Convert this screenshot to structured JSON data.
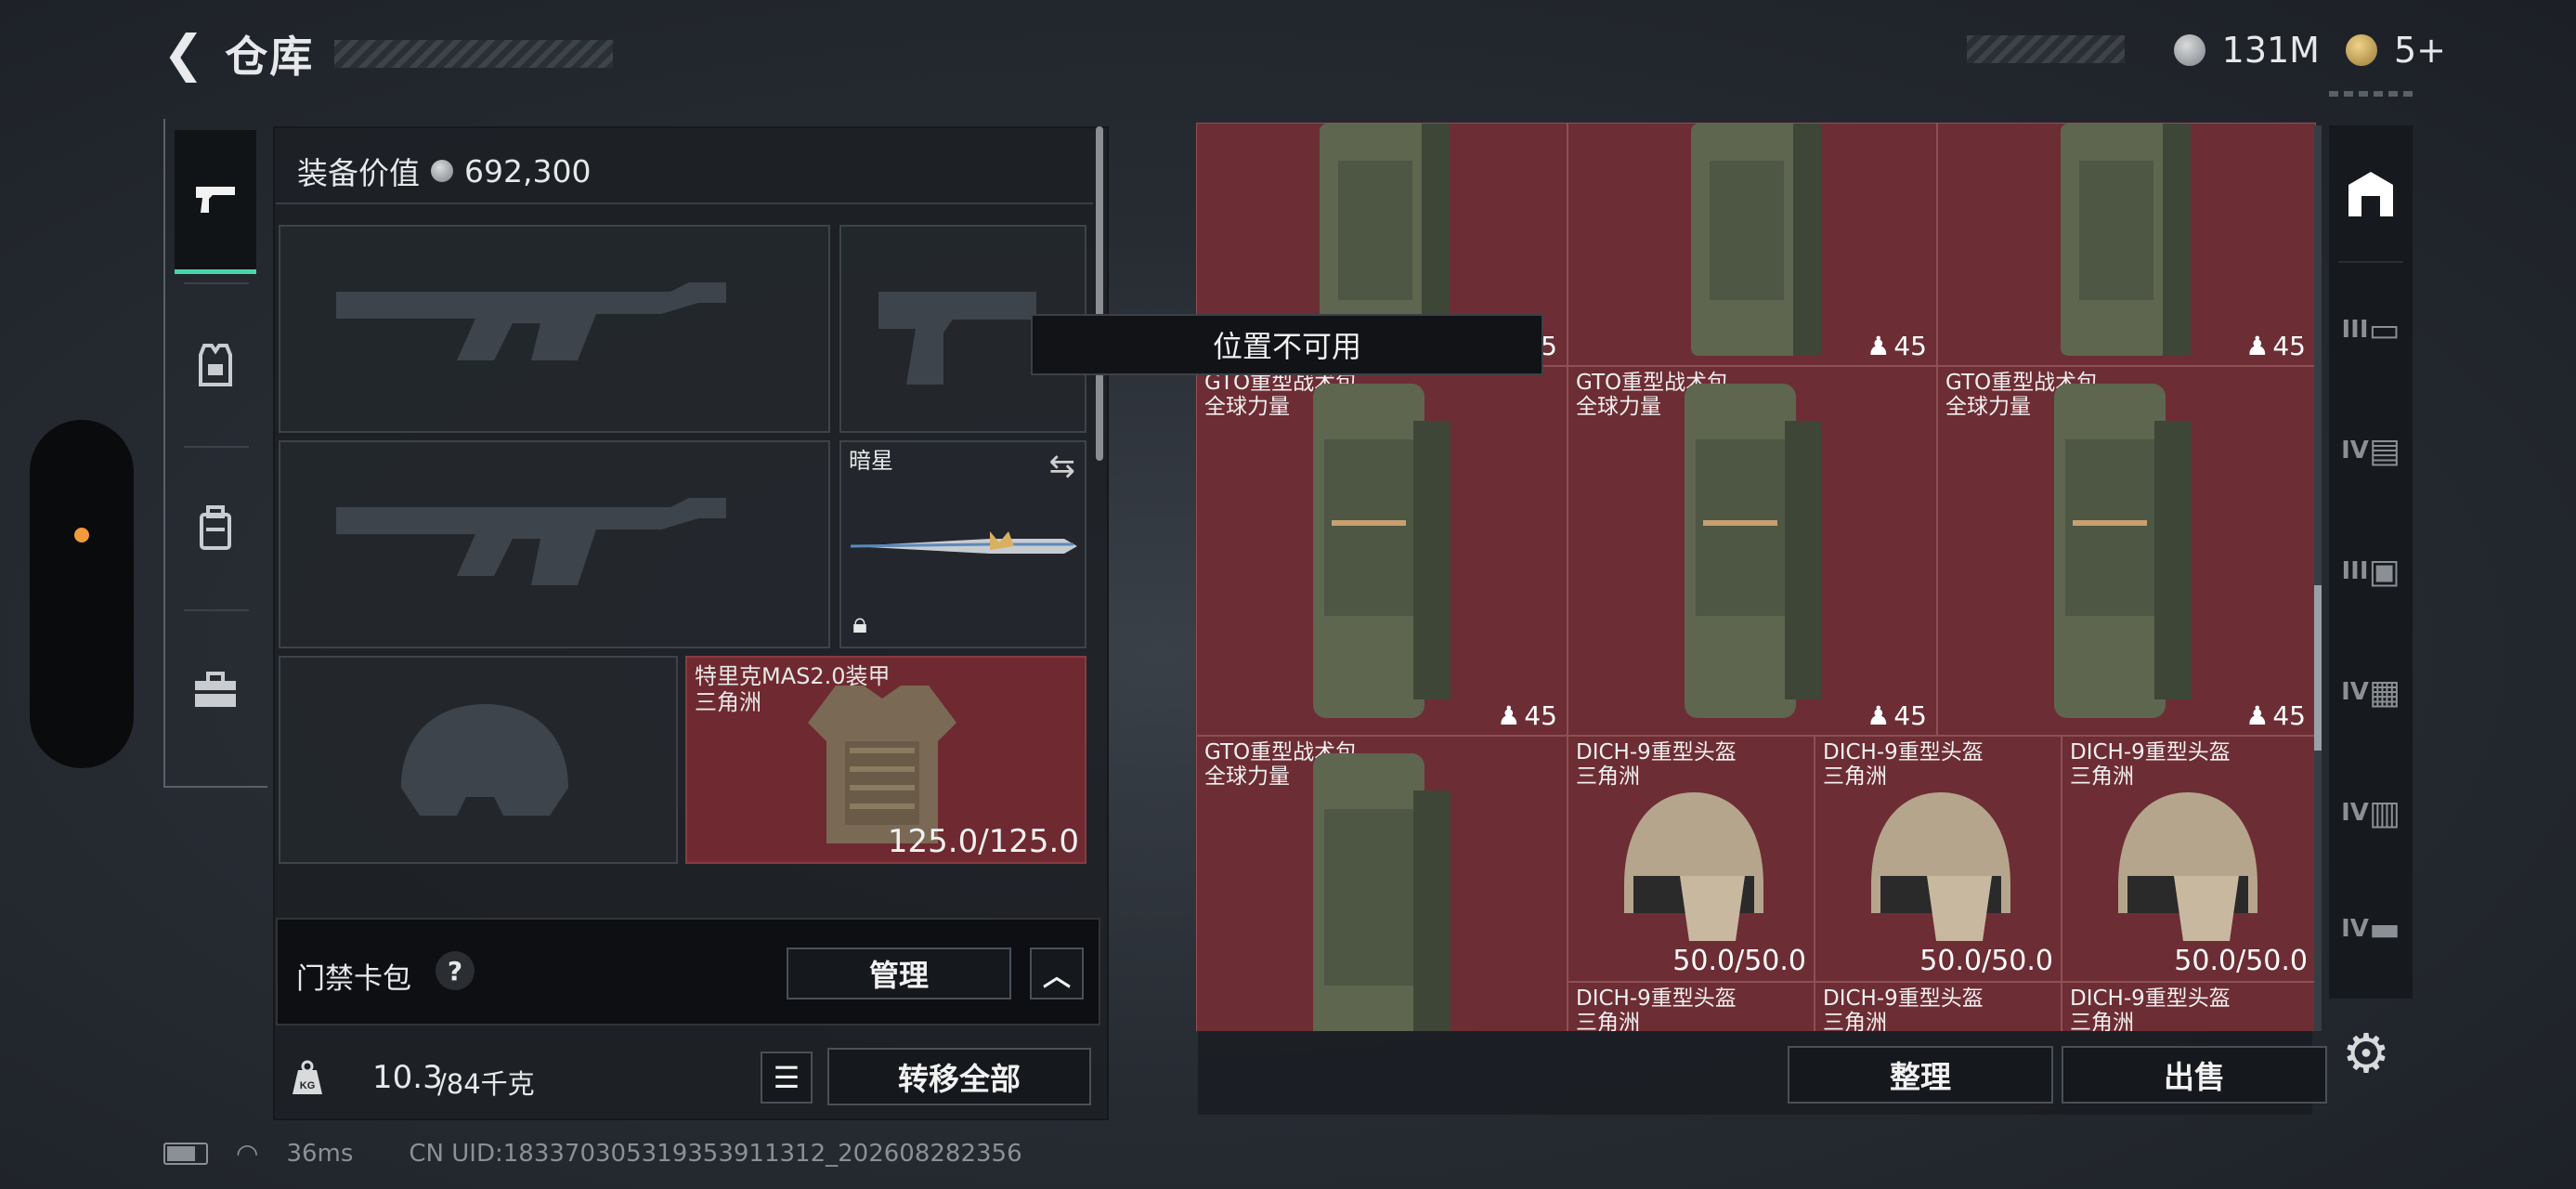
{
  "header": {
    "title": "仓库"
  },
  "currency": {
    "silver": "131M",
    "gold": "5+"
  },
  "equipment": {
    "value_label": "装备价值",
    "value": "692,300",
    "knife_name": "暗星",
    "armor_name": "特里克MAS2.0装甲",
    "armor_region": "三角洲",
    "armor_durability": "125.0/125.0"
  },
  "card_pack": {
    "label": "门禁卡包",
    "help": "?",
    "manage": "管理"
  },
  "weight": {
    "icon": "KG",
    "current": "10.3",
    "max": "/84千克",
    "transfer_all": "转移全部"
  },
  "tooltip": "位置不可用",
  "grid": {
    "backpack_name": "GTO重型战术包",
    "backpack_region": "全球力量",
    "backpack_count": "45",
    "helmet_name": "DICH-9重型头盔",
    "helmet_region": "三角洲",
    "helmet_durability": "50.0/50.0"
  },
  "buttons": {
    "organize": "整理",
    "sell": "出售"
  },
  "filters": [
    "III",
    "IV",
    "III",
    "IV",
    "IV",
    "IV"
  ],
  "footer": {
    "ping": "36ms",
    "uid": "CN UID:183370305319353911312_202608282356"
  },
  "icons": [
    "back-arrow-icon",
    "silver-coin-icon",
    "gold-coin-icon",
    "pistol-icon",
    "vest-icon",
    "backpack-icon",
    "toolbox-icon",
    "lock-icon",
    "swap-icon",
    "help-icon",
    "chevron-up-icon",
    "weight-icon",
    "list-icon",
    "home-filter-icon",
    "settings-gear-icon",
    "battery-icon",
    "wifi-icon"
  ]
}
